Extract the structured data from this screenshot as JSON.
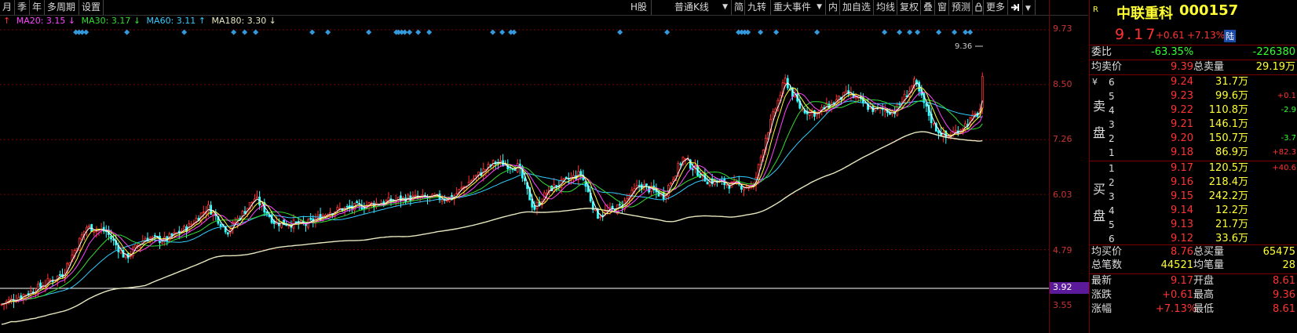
{
  "toolbar": {
    "period_items": [
      "月",
      "季",
      "年",
      "多周期",
      "设置"
    ],
    "right_items": [
      "H股",
      "普通K线",
      "简",
      "九转",
      "重大事件",
      "内",
      "加自选",
      "均线",
      "复权",
      "叠",
      "窗",
      "预测",
      "更多"
    ]
  },
  "ma_legend": [
    {
      "label": "MA20: 3.15",
      "arrow": "↓",
      "color": "#ff44ff"
    },
    {
      "label": "MA30: 3.17",
      "arrow": "↓",
      "color": "#33dd33"
    },
    {
      "label": "MA60: 3.11",
      "arrow": "↑",
      "color": "#33ccff"
    },
    {
      "label": "MA180: 3.30",
      "arrow": "↓",
      "color": "#e8e8c0"
    }
  ],
  "price_axis": {
    "labels": [
      "9.73",
      "8.50",
      "7.26",
      "6.03",
      "4.79",
      "3.92",
      "3.55"
    ],
    "current_highlight": "3.92",
    "max_marker": "9.36"
  },
  "stock": {
    "name": "中联重科",
    "code": "000157",
    "price": "9.17",
    "change": "+0.61",
    "change_pct": "+7.13%",
    "exchange_badge": "陆"
  },
  "order_summary": {
    "ratio_label": "委比",
    "ratio_value": "-63.35%",
    "ratio_diff": "-226380",
    "avg_sell_label": "均卖价",
    "avg_sell_value": "9.39",
    "total_sell_label": "总卖量",
    "total_sell_value": "29.19万"
  },
  "sell_orders": [
    {
      "level": "6",
      "price": "9.24",
      "volume": "31.7万",
      "delta": ""
    },
    {
      "level": "5",
      "price": "9.23",
      "volume": "99.6万",
      "delta": "+0.1"
    },
    {
      "level": "4",
      "price": "9.22",
      "volume": "110.8万",
      "delta": "-2.9"
    },
    {
      "level": "3",
      "price": "9.21",
      "volume": "146.1万",
      "delta": ""
    },
    {
      "level": "2",
      "price": "9.20",
      "volume": "150.7万",
      "delta": "-3.7"
    },
    {
      "level": "1",
      "price": "9.18",
      "volume": "86.9万",
      "delta": "+82.3"
    }
  ],
  "sell_label": [
    "卖",
    "盘"
  ],
  "sell_currency": "¥",
  "buy_orders": [
    {
      "level": "1",
      "price": "9.17",
      "volume": "120.5万",
      "delta": "+40.6"
    },
    {
      "level": "2",
      "price": "9.16",
      "volume": "218.4万",
      "delta": ""
    },
    {
      "level": "3",
      "price": "9.15",
      "volume": "242.2万",
      "delta": ""
    },
    {
      "level": "4",
      "price": "9.14",
      "volume": "12.2万",
      "delta": ""
    },
    {
      "level": "5",
      "price": "9.13",
      "volume": "21.7万",
      "delta": ""
    },
    {
      "level": "6",
      "price": "9.12",
      "volume": "33.6万",
      "delta": ""
    }
  ],
  "buy_label": [
    "买",
    "盘"
  ],
  "buy_summary": {
    "avg_buy_label": "均买价",
    "avg_buy_value": "8.76",
    "total_buy_label": "总买量",
    "total_buy_value": "65475",
    "total_trades_label": "总笔数",
    "total_trades_value": "44521",
    "avg_trade_label": "均笔量",
    "avg_trade_value": "28"
  },
  "stats": [
    {
      "l1": "最新",
      "v1": "9.17",
      "l2": "开盘",
      "v2": "8.61"
    },
    {
      "l1": "涨跌",
      "v1": "+0.61",
      "l2": "最高",
      "v2": "9.36"
    },
    {
      "l1": "涨幅",
      "v1": "+7.13%",
      "l2": "最低",
      "v2": "8.61"
    }
  ],
  "colors": {
    "up": "#ff3333",
    "down": "#33ffff",
    "ma5": "#ffffff",
    "ma10": "#ffff33",
    "ma20": "#ff44ff",
    "ma30": "#33dd33",
    "ma60": "#33ccff",
    "ma180": "#e8e8c0",
    "title": "#ffff33",
    "grid": "#7a0000"
  }
}
